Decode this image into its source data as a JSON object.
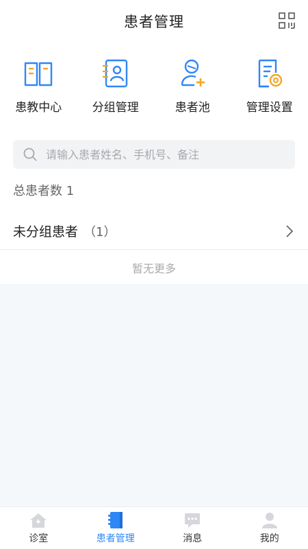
{
  "header": {
    "title": "患者管理",
    "qr_icon": "qr-scan-icon"
  },
  "shortcuts": [
    {
      "label": "患教中心",
      "icon": "book-icon"
    },
    {
      "label": "分组管理",
      "icon": "contact-book-icon"
    },
    {
      "label": "患者池",
      "icon": "add-user-icon"
    },
    {
      "label": "管理设置",
      "icon": "doc-settings-icon"
    }
  ],
  "search": {
    "placeholder": "请输入患者姓名、手机号、备注",
    "value": ""
  },
  "summary": {
    "total_label": "总患者数 1"
  },
  "groups": [
    {
      "name": "未分组患者",
      "count": "（1）"
    }
  ],
  "list_footer": "暂无更多",
  "tabbar": [
    {
      "label": "诊室",
      "icon": "home-icon",
      "active": false
    },
    {
      "label": "患者管理",
      "icon": "patient-book-icon",
      "active": true
    },
    {
      "label": "消息",
      "icon": "message-icon",
      "active": false
    },
    {
      "label": "我的",
      "icon": "user-icon",
      "active": false
    }
  ],
  "colors": {
    "accent": "#2f86f6",
    "icon_orange": "#f5a623",
    "inactive_icon": "#d5d7db"
  }
}
